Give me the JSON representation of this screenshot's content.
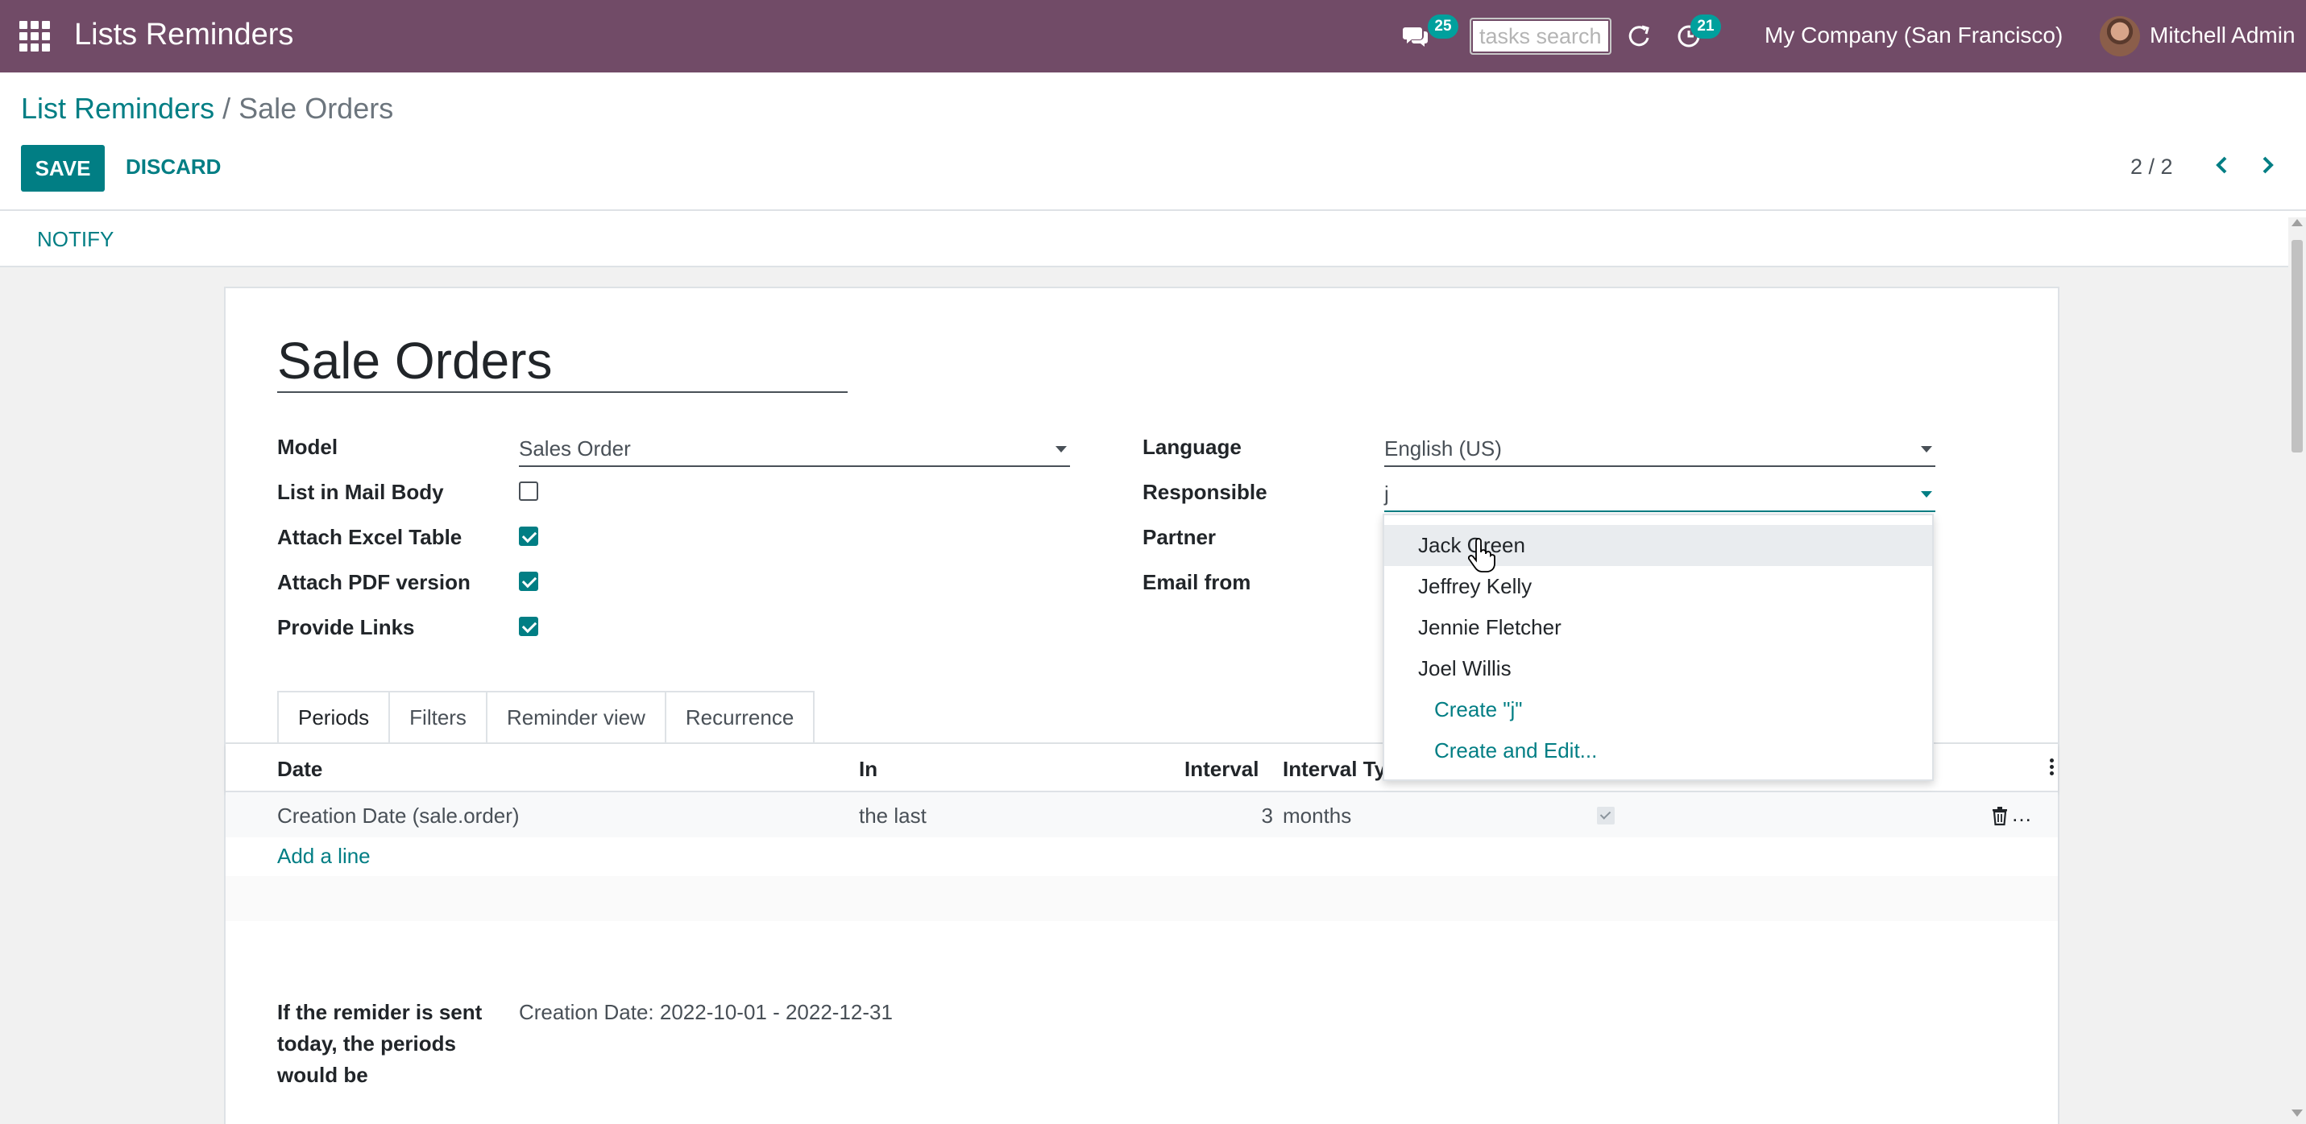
{
  "navbar": {
    "app_title": "Lists Reminders",
    "chat_badge": "25",
    "search_placeholder": "tasks search",
    "activity_badge": "21",
    "company": "My Company (San Francisco)",
    "user": "Mitchell Admin",
    "bg_color": "#714b67"
  },
  "breadcrumb": {
    "parent": "List Reminders",
    "separator": "/",
    "current": "Sale Orders"
  },
  "toolbar": {
    "save_label": "SAVE",
    "discard_label": "DISCARD",
    "pager": "2 / 2"
  },
  "statusbar": {
    "notify_label": "NOTIFY"
  },
  "form": {
    "name": "Sale Orders",
    "left_fields": {
      "model_label": "Model",
      "model_value": "Sales Order",
      "list_in_mail_label": "List in Mail Body",
      "list_in_mail_checked": false,
      "attach_excel_label": "Attach Excel Table",
      "attach_excel_checked": true,
      "attach_pdf_label": "Attach PDF version",
      "attach_pdf_checked": true,
      "provide_links_label": "Provide Links",
      "provide_links_checked": true
    },
    "right_fields": {
      "language_label": "Language",
      "language_value": "English (US)",
      "responsible_label": "Responsible",
      "responsible_value": "j",
      "partner_label": "Partner",
      "email_from_label": "Email from"
    },
    "tabs": [
      {
        "label": "Periods",
        "active": true
      },
      {
        "label": "Filters",
        "active": false
      },
      {
        "label": "Reminder view",
        "active": false
      },
      {
        "label": "Recurrence",
        "active": false
      }
    ],
    "table": {
      "headers": {
        "date": "Date",
        "in": "In",
        "interval": "Interval",
        "interval_type": "Interval Typ"
      },
      "rows": [
        {
          "date": "Creation Date (sale.order)",
          "in": "the last",
          "interval": "3",
          "interval_type": "months",
          "checked": true
        }
      ],
      "add_line": "Add a line"
    },
    "periods_label": "If the remider is sent today, the periods would be",
    "periods_value": "Creation Date: 2022-10-01 - 2022-12-31"
  },
  "dropdown": {
    "items": [
      "Jack Green",
      "Jeffrey Kelly",
      "Jennie Fletcher",
      "Joel Willis"
    ],
    "create_label": "Create \"j\"",
    "create_edit_label": "Create and Edit..."
  },
  "colors": {
    "accent": "#017e84",
    "brand": "#714b67"
  }
}
